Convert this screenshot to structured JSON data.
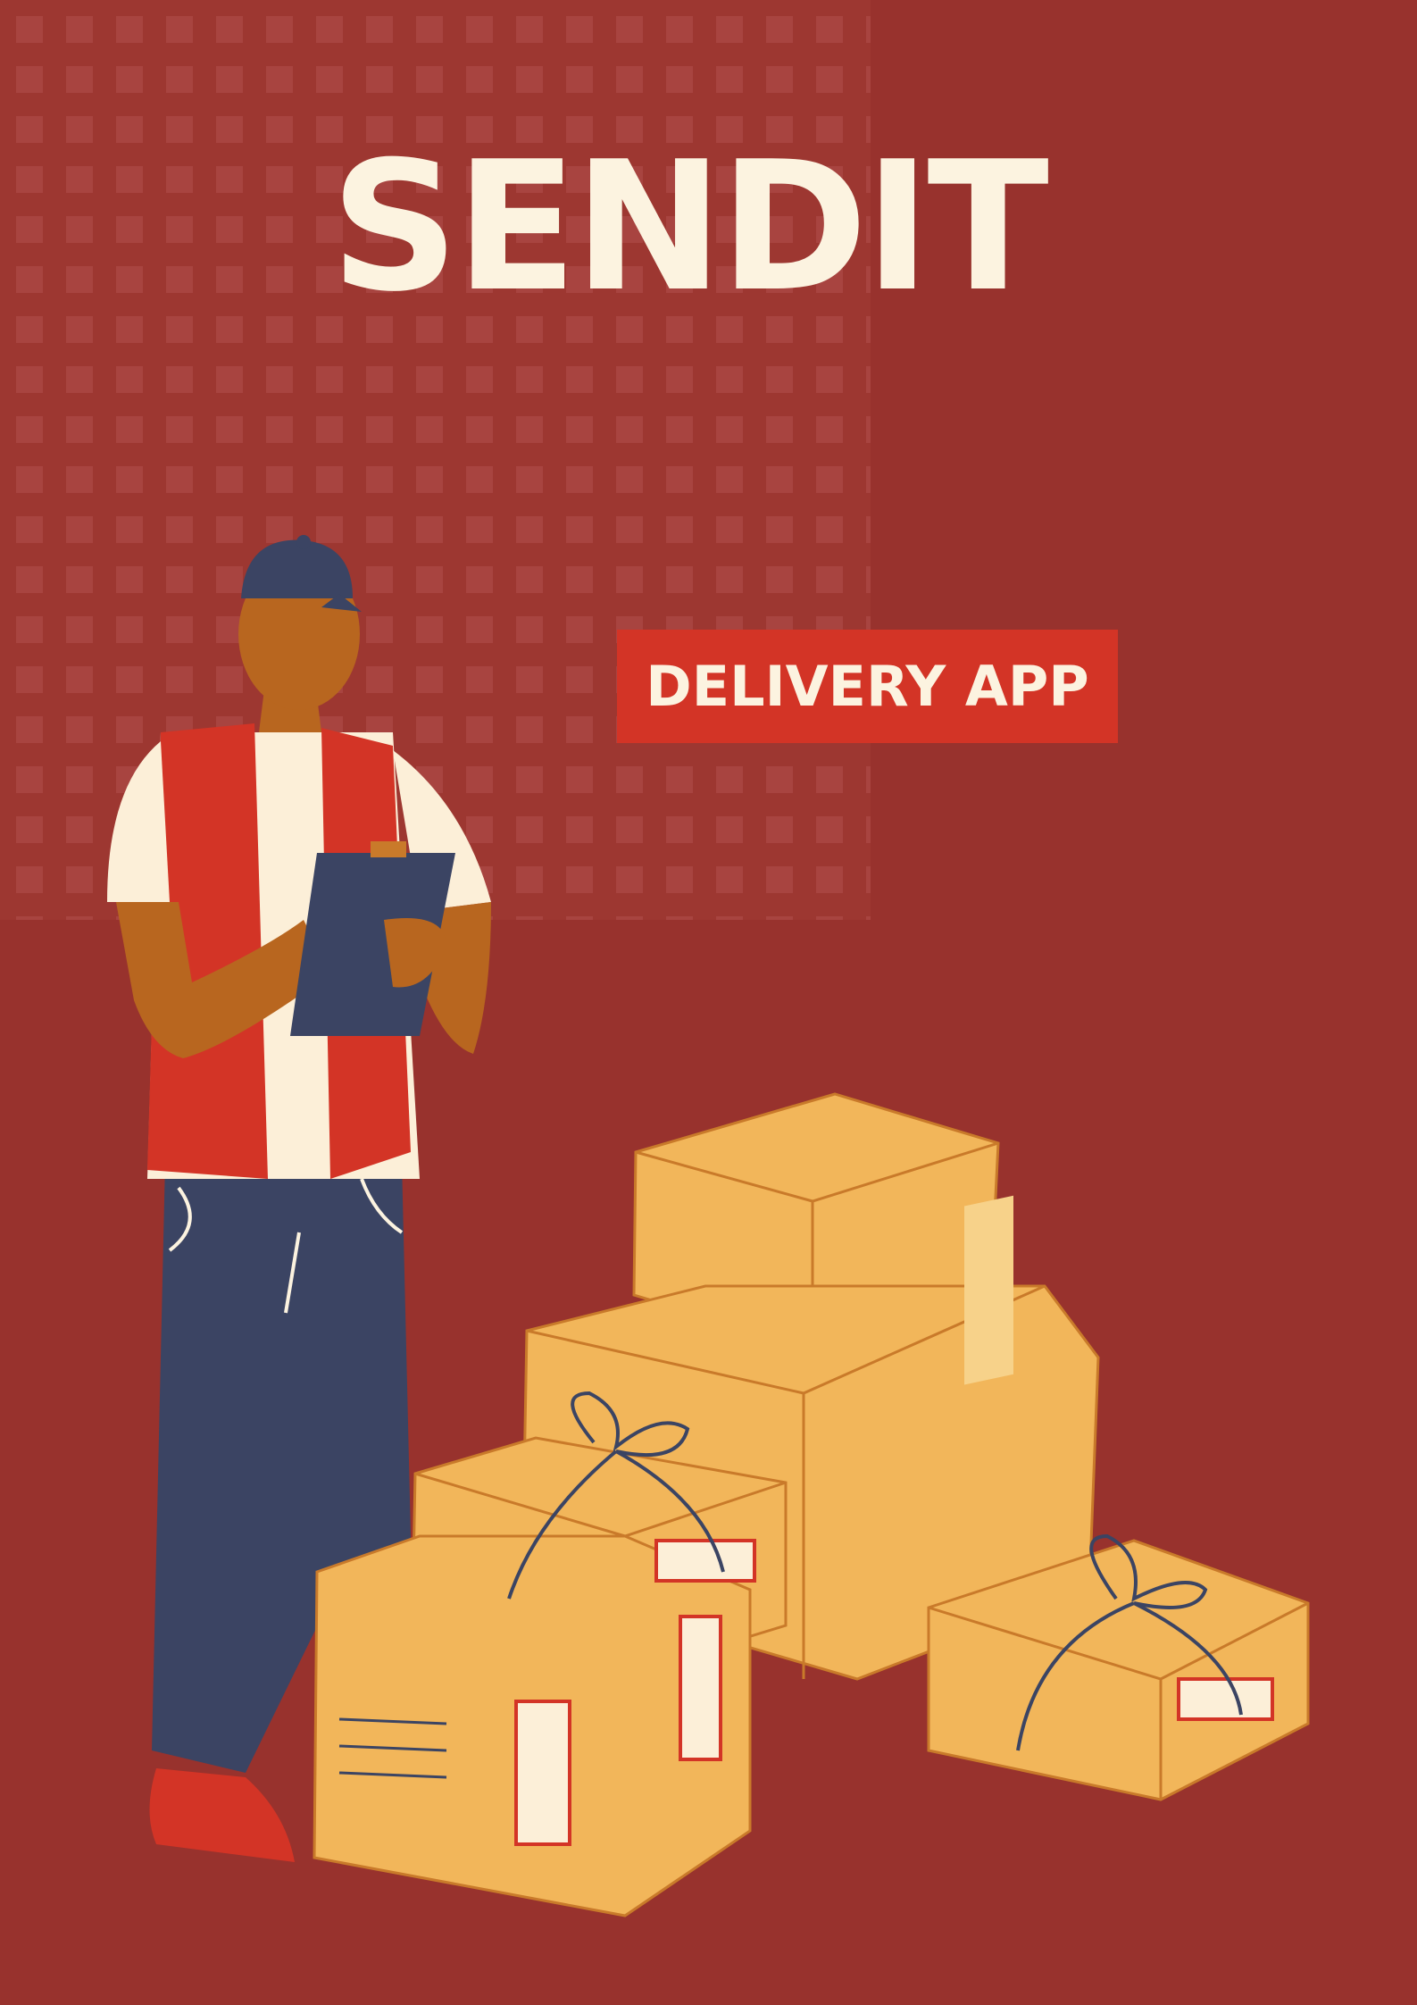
{
  "poster": {
    "title": "SENDIT",
    "badge": "DELIVERY APP"
  },
  "colors": {
    "background": "#98322d",
    "pattern": "#a84440",
    "title_text": "#fcf3e0",
    "badge_bg": "#d33426",
    "box": "#f2b65a",
    "box_edge": "#c97a2a",
    "uniform_navy": "#3b4463",
    "vest_red": "#d33426",
    "skin": "#b8661f"
  },
  "illustration": {
    "subject": "delivery-courier-with-clipboard",
    "objects": [
      "stacked-parcels"
    ]
  }
}
